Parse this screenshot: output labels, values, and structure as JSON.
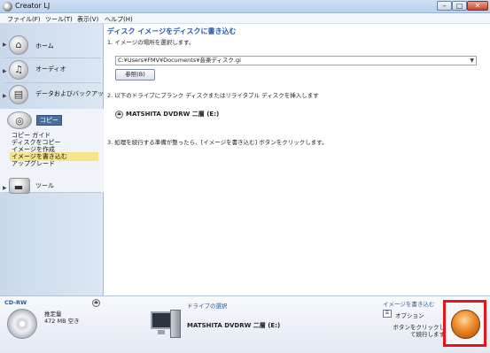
{
  "window": {
    "title": "Creator LJ"
  },
  "menu": [
    "ファイル(F)",
    "ツール(T)",
    "表示(V)",
    "ヘルプ(H)"
  ],
  "sidebar": {
    "items": [
      {
        "label": "ホーム",
        "icon": "home-icon"
      },
      {
        "label": "オーディオ",
        "icon": "headphones-icon"
      },
      {
        "label": "データおよびバックアップ",
        "icon": "folder-icon"
      },
      {
        "label": "コピー",
        "icon": "disc-copy-icon"
      },
      {
        "label": "ツール",
        "icon": "toolbox-icon"
      }
    ],
    "copy_subitems": [
      "コピー ガイド",
      "ディスクをコピー",
      "イメージを作成",
      "イメージを書き込む",
      "アップグレード"
    ],
    "active_subitem": "イメージを書き込む"
  },
  "main": {
    "title": "ディスク イメージをディスクに書き込む",
    "step1": "1. イメージの場所を選択します。",
    "image_path": "C:¥Users¥FMV¥Documents¥音楽ディスク.gi",
    "browse_label": "参照(B)",
    "step2": "2. 以下のドライブにブランク ディスクまたはリライタブル ディスクを挿入します",
    "drive_name": "MATSHITA DVDRW 二層 (E:)",
    "step3": "3. 処理を続行する準備が整ったら、[イメージを書き込む] ボタンをクリックします。"
  },
  "bottom": {
    "media_type": "CD-RW",
    "capacity_label": "推定量",
    "capacity_value": "472 MB 空き",
    "drive_select_label": "ドライブの選択",
    "drive_name": "MATSHITA DVDRW 二層 (E:)",
    "write_label": "イメージを書き込む",
    "option_label": "オプション",
    "hint": "ボタンをクリックして続行します"
  },
  "colors": {
    "accent": "#2b58a5",
    "highlight_frame": "#e8141b",
    "write_button": "#f0902e"
  }
}
